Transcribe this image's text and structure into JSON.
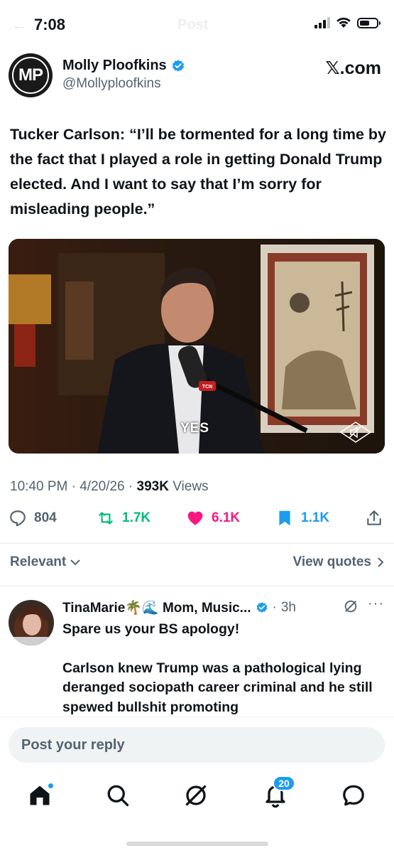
{
  "status_bar": {
    "time": "7:08",
    "ghost_title": "Post",
    "signal_bars": 4,
    "signal_active": 3,
    "battery_level": 0.6
  },
  "post": {
    "author_name": "Molly Ploofkins",
    "author_handle": "@Mollyploofkins",
    "avatar_initials": "MP",
    "source": "𝕏.com",
    "text": "Tucker Carlson: “I’ll be tormented for a long time by the fact that I played a role in getting Donald Trump elected. And I want to say that I’m sorry for misleading people.”",
    "media": {
      "caption": "YES",
      "mic_label": "TCN",
      "watermark": "THE TUCKER CARLSON SHOW"
    },
    "meta": {
      "time": "10:40 PM",
      "date": "4/20/26",
      "views_count": "393K",
      "views_label": "Views"
    },
    "actions": {
      "replies": "804",
      "reposts": "1.7K",
      "likes": "6.1K",
      "bookmarks": "1.1K"
    }
  },
  "filter": {
    "sort_label": "Relevant",
    "quotes_label": "View quotes"
  },
  "reply": {
    "name": "TinaMarie🌴🌊 Mom, Music...",
    "time": "3h",
    "body_1": "Spare us your BS apology!",
    "body_2": "Carlson knew Trump was a pathological lying deranged sociopath career criminal and he still spewed bullshit promoting"
  },
  "composer": {
    "placeholder": "Post your reply"
  },
  "nav": {
    "notifications_badge": "20"
  },
  "colors": {
    "accent": "#1d9bf0",
    "repost": "#00ba7c",
    "like": "#f91880",
    "muted": "#536471"
  }
}
